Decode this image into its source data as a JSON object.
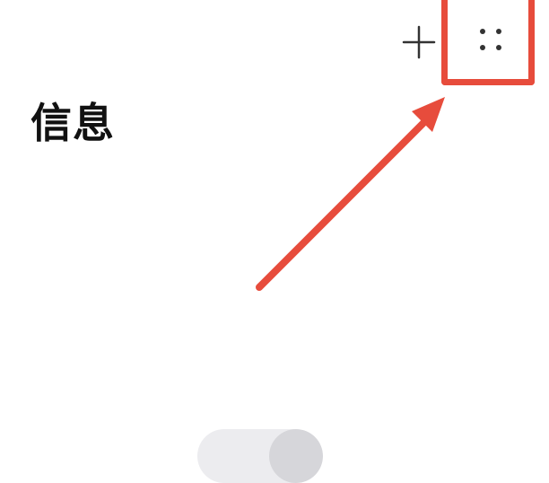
{
  "header": {
    "title": "信息",
    "add_icon": "plus-icon",
    "more_icon": "more-dots-icon"
  },
  "annotation": {
    "color": "#e74c3c",
    "target": "more-button"
  },
  "colors": {
    "background": "#ffffff",
    "text": "#111111",
    "pill": "#ececef",
    "pill_knob": "#d6d6da"
  }
}
